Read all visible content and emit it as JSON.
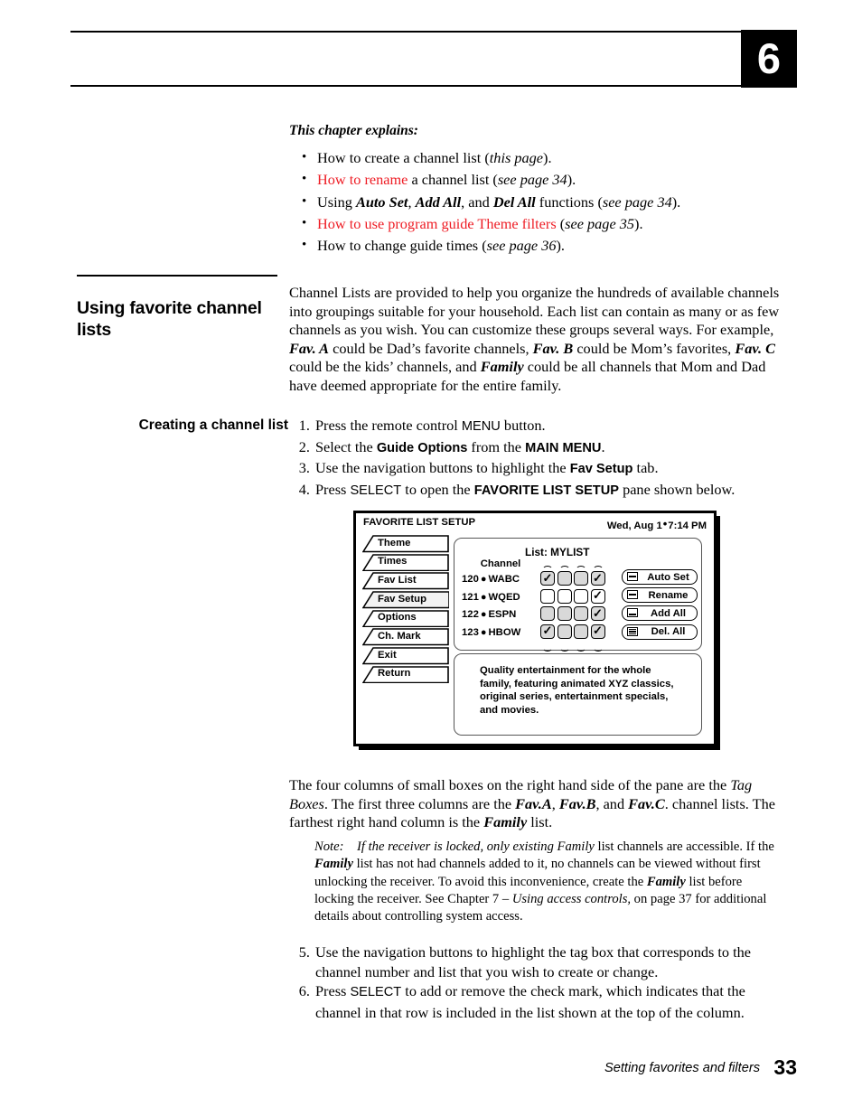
{
  "header": {
    "chapter_number": "6"
  },
  "intro": {
    "title": "This chapter explains:",
    "bullets": [
      {
        "text": "How to create a channel list (this page).",
        "highlight": false
      },
      {
        "text": "How to rename a channel list (see page 34).",
        "highlight": true
      },
      {
        "text": "Using Auto Set, Add All, and Del All functions (see page 34).",
        "highlight": false
      },
      {
        "text": "How to use program guide Theme filters (see page 35).",
        "highlight": true
      },
      {
        "text": "How to change guide times (see page 36).",
        "highlight": false
      }
    ]
  },
  "section": {
    "title": "Using favorite channel lists",
    "body": "Channel Lists are provided to help you organize the hundreds of available channels into groupings suitable for your household. Each list can contain as many or as few channels as you wish. You can customize these groups several ways. For example, Fav. A could be Dad's favorite channels, Fav. B could be Mom's favorites, Fav. C could be the kids' channels, and Family could be all channels that Mom and Dad have deemed appropriate for the entire family."
  },
  "subsection": {
    "title": "Creating a channel list",
    "steps": [
      {
        "num": "1.",
        "text": "Press the remote control MENU button."
      },
      {
        "num": "2.",
        "text": "Select the Guide Options from the MAIN MENU."
      },
      {
        "num": "3.",
        "text": "Use the navigation buttons to highlight the Fav Setup tab."
      },
      {
        "num": "4.",
        "text": "Press SELECT to open the FAVORITE LIST SETUP pane shown below."
      }
    ]
  },
  "figure": {
    "title": "FAVORITE LIST SETUP",
    "date": "Wed, Aug 1",
    "separator": "•",
    "time": "7:14 PM",
    "tabs": [
      {
        "label": "Theme",
        "selected": false
      },
      {
        "label": "Times",
        "selected": false
      },
      {
        "label": "Fav List",
        "selected": false
      },
      {
        "label": "Fav Setup",
        "selected": true
      },
      {
        "label": "Options",
        "selected": false
      },
      {
        "label": "Ch. Mark",
        "selected": false
      },
      {
        "label": "Exit",
        "selected": false
      },
      {
        "label": "Return",
        "selected": false
      }
    ],
    "list_label": "List:  MYLIST",
    "channel_header": "Channel",
    "channels": [
      {
        "number": "120",
        "dot": "●",
        "name": "WABC",
        "tags": [
          true,
          false,
          false,
          true
        ]
      },
      {
        "number": "121",
        "dot": "●",
        "name": "WQED",
        "tags": [
          false,
          false,
          false,
          true
        ]
      },
      {
        "number": "122",
        "dot": "●",
        "name": "ESPN",
        "tags": [
          false,
          false,
          false,
          true
        ]
      },
      {
        "number": "123",
        "dot": "●",
        "name": "HBOW",
        "tags": [
          true,
          false,
          false,
          true
        ]
      }
    ],
    "check_glyph": "✓",
    "buttons": [
      {
        "label": "Auto Set",
        "icon": "minus-bar-icon",
        "lines": 1
      },
      {
        "label": "Rename",
        "icon": "minus-bar-icon",
        "lines": 1
      },
      {
        "label": "Add All",
        "icon": "bottom-bar-icon",
        "lines": 1
      },
      {
        "label": "Del. All",
        "icon": "stacked-lines-icon",
        "lines": 3
      }
    ],
    "description": "Quality entertainment for the whole family, featuring animated XYZ classics, original series, entertainment specials, and movies."
  },
  "after_figure": {
    "paragraph": "The four columns of small boxes on the right hand side of the pane are the Tag Boxes. The first three columns are the Fav.A, Fav.B, and Fav.C. channel lists. The farthest right hand column is the Family list.",
    "note_label": "Note:",
    "note_text": "If the receiver is locked, only existing Family list channels are accessible. If the Family list has not had channels added to it, no channels can be viewed without first unlocking the receiver. To avoid this inconvenience, create the Family list before locking the receiver. See Chapter 7 – Using access controls, on page 37 for additional details about controlling system access."
  },
  "steps_continued": [
    {
      "num": "5.",
      "text": "Use the navigation buttons to highlight the tag box that corresponds to the channel number and list that you wish to create or change."
    },
    {
      "num": "6.",
      "text": "Press SELECT to add or remove the check mark, which indicates that the channel in that row is included in the list shown at the top of the column."
    }
  ],
  "footer": {
    "running_head": "Setting favorites and filters",
    "page_number": "33"
  },
  "colors": {
    "highlight_red": "#ee1c24",
    "text_black": "#000000",
    "tab_shade": "#d9d9d9"
  }
}
